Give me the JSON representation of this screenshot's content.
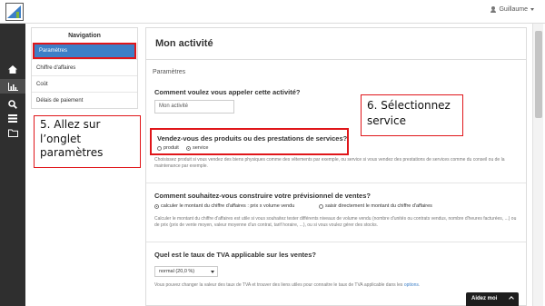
{
  "topbar": {
    "user_name": "Guillaume"
  },
  "nav": {
    "title": "Navigation",
    "items": [
      {
        "label": "Paramètres"
      },
      {
        "label": "Chiffre d'affaires"
      },
      {
        "label": "Coût"
      },
      {
        "label": "Délais de paiement"
      }
    ]
  },
  "main": {
    "title": "Mon activité",
    "section": "Paramètres",
    "q1": {
      "label": "Comment voulez vous appeler cette activité?",
      "value": "Mon activité"
    },
    "q2": {
      "label": "Vendez-vous des produits ou des prestations de services?",
      "options": [
        "produit",
        "service"
      ],
      "selected": "service",
      "help": "Choisissez produit si vous vendez des biens physiques comme des vêtements par exemple, ou service si vous vendez des prestations de services comme du conseil ou de la maintenance par exemple."
    },
    "q3": {
      "label": "Comment souhaitez-vous construire votre prévisionnel de ventes?",
      "options": [
        "calculer le montant du chiffre d'affaires : prix x volume vendu",
        "saisir directement le montant du chiffre d'affaires"
      ],
      "selected": "calculer le montant du chiffre d'affaires : prix x volume vendu",
      "help": "Calculer le montant du chiffre d'affaires est utile si vous souhaitez tester différents niveaux de volume vendu (nombre d'unités ou contrats vendus, nombre d'heures facturées, ...) ou de prix (prix de vente moyen, valeur moyenne d'un contrat, tarif horaire, ...), ou si vous voulez gérer des stocks."
    },
    "q4": {
      "label": "Quel est le taux de TVA applicable sur les ventes?",
      "value": "normal (20,0 %)",
      "help_prefix": "Vous pouvez changer la valeur des taux de TVA et trouver des liens utiles pour connaitre le taux de TVA applicable dans les",
      "help_link": "options",
      "help_suffix": "."
    }
  },
  "annotations": {
    "step5": "5. Allez sur l’onglet paramètres",
    "step6": "6. Sélectionnez service"
  },
  "help_widget": {
    "label": "Aidez moi"
  },
  "colors": {
    "accent": "#3d7fc7",
    "highlight": "#e0161a",
    "sidebar": "#2f2f2f"
  }
}
